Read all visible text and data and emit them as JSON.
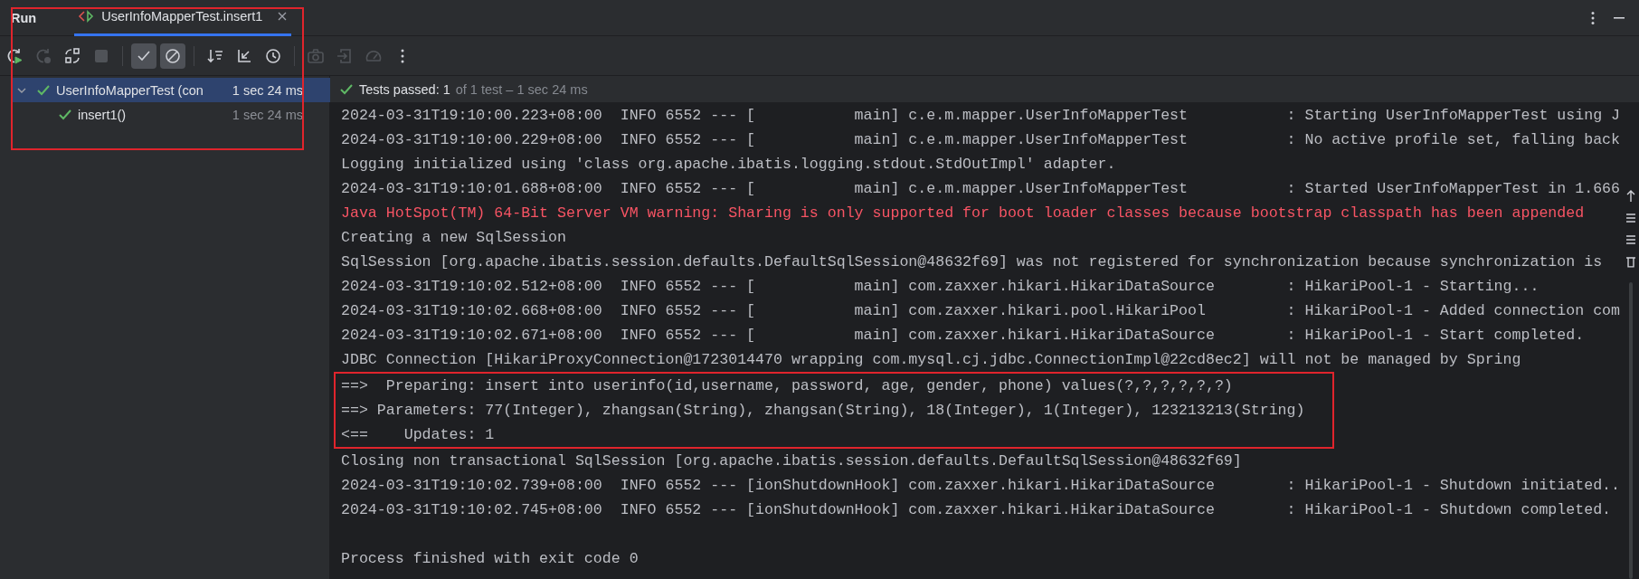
{
  "tool_window": {
    "title": "Run",
    "tabs": [
      {
        "label": "UserInfoMapperTest.insert1",
        "selected": true
      }
    ],
    "framed": true
  },
  "toolbar": [
    [
      {
        "kind": "rerun",
        "on": false,
        "disabled": false
      },
      {
        "kind": "rerun-failed",
        "on": false,
        "disabled": true
      },
      {
        "kind": "toggle-auto",
        "on": false,
        "disabled": false
      },
      {
        "kind": "stop",
        "on": false,
        "disabled": true
      }
    ],
    [
      {
        "kind": "show-passed",
        "on": true,
        "disabled": false
      },
      {
        "kind": "show-ignored",
        "on": true,
        "disabled": false
      }
    ],
    [
      {
        "kind": "sort",
        "on": false,
        "disabled": false
      },
      {
        "kind": "collapse",
        "on": false,
        "disabled": false
      },
      {
        "kind": "history",
        "on": false,
        "disabled": false
      }
    ],
    [
      {
        "kind": "camera",
        "on": false,
        "disabled": true
      },
      {
        "kind": "import",
        "on": false,
        "disabled": true
      },
      {
        "kind": "gauge",
        "on": false,
        "disabled": true
      },
      {
        "kind": "more",
        "on": false,
        "disabled": false
      }
    ]
  ],
  "tree": [
    {
      "label": "UserInfoMapperTest (con",
      "time": "1 sec 24 ms",
      "expanded": true,
      "selected": true,
      "children": [
        {
          "label": "insert1()",
          "time": "1 sec 24 ms",
          "selected": false
        }
      ]
    }
  ],
  "status": {
    "label": "Tests passed:",
    "count": "1",
    "detail": "of 1 test – 1 sec 24 ms"
  },
  "console": [
    {
      "kind": "clipped",
      "highlighted": false,
      "text": "2024-03-31T19:10:00.223+08:00  INFO 6552 --- [           main] c.e.m.mapper.UserInfoMapperTest           : Starting UserInfoMapperTest using J"
    },
    {
      "kind": "log",
      "highlighted": false,
      "text": "2024-03-31T19:10:00.229+08:00  INFO 6552 --- [           main] c.e.m.mapper.UserInfoMapperTest           : No active profile set, falling back"
    },
    {
      "kind": "log",
      "highlighted": false,
      "text": "Logging initialized using 'class org.apache.ibatis.logging.stdout.StdOutImpl' adapter."
    },
    {
      "kind": "log",
      "highlighted": false,
      "text": "2024-03-31T19:10:01.688+08:00  INFO 6552 --- [           main] c.e.m.mapper.UserInfoMapperTest           : Started UserInfoMapperTest in 1.666"
    },
    {
      "kind": "error",
      "highlighted": false,
      "text": "Java HotSpot(TM) 64-Bit Server VM warning: Sharing is only supported for boot loader classes because bootstrap classpath has been appended"
    },
    {
      "kind": "log",
      "highlighted": false,
      "text": "Creating a new SqlSession"
    },
    {
      "kind": "log",
      "highlighted": false,
      "text": "SqlSession [org.apache.ibatis.session.defaults.DefaultSqlSession@48632f69] was not registered for synchronization because synchronization is"
    },
    {
      "kind": "log",
      "highlighted": false,
      "text": "2024-03-31T19:10:02.512+08:00  INFO 6552 --- [           main] com.zaxxer.hikari.HikariDataSource        : HikariPool-1 - Starting..."
    },
    {
      "kind": "log",
      "highlighted": false,
      "text": "2024-03-31T19:10:02.668+08:00  INFO 6552 --- [           main] com.zaxxer.hikari.pool.HikariPool         : HikariPool-1 - Added connection com"
    },
    {
      "kind": "log",
      "highlighted": false,
      "text": "2024-03-31T19:10:02.671+08:00  INFO 6552 --- [           main] com.zaxxer.hikari.HikariDataSource        : HikariPool-1 - Start completed."
    },
    {
      "kind": "log",
      "highlighted": false,
      "text": "JDBC Connection [HikariProxyConnection@1723014470 wrapping com.mysql.cj.jdbc.ConnectionImpl@22cd8ec2] will not be managed by Spring"
    },
    {
      "kind": "log",
      "highlighted": true,
      "text": "==>  Preparing: insert into userinfo(id,username, password, age, gender, phone) values(?,?,?,?,?,?)"
    },
    {
      "kind": "log",
      "highlighted": true,
      "text": "==> Parameters: 77(Integer), zhangsan(String), zhangsan(String), 18(Integer), 1(Integer), 123213213(String)"
    },
    {
      "kind": "log",
      "highlighted": true,
      "text": "<==    Updates: 1"
    },
    {
      "kind": "log",
      "highlighted": false,
      "text": "Closing non transactional SqlSession [org.apache.ibatis.session.defaults.DefaultSqlSession@48632f69]"
    },
    {
      "kind": "log",
      "highlighted": false,
      "text": "2024-03-31T19:10:02.739+08:00  INFO 6552 --- [ionShutdownHook] com.zaxxer.hikari.HikariDataSource        : HikariPool-1 - Shutdown initiated.."
    },
    {
      "kind": "log",
      "highlighted": false,
      "text": "2024-03-31T19:10:02.745+08:00  INFO 6552 --- [ionShutdownHook] com.zaxxer.hikari.HikariDataSource        : HikariPool-1 - Shutdown completed."
    },
    {
      "kind": "blank",
      "highlighted": false
    },
    {
      "kind": "log",
      "highlighted": false,
      "text": "Process finished with exit code 0"
    }
  ]
}
